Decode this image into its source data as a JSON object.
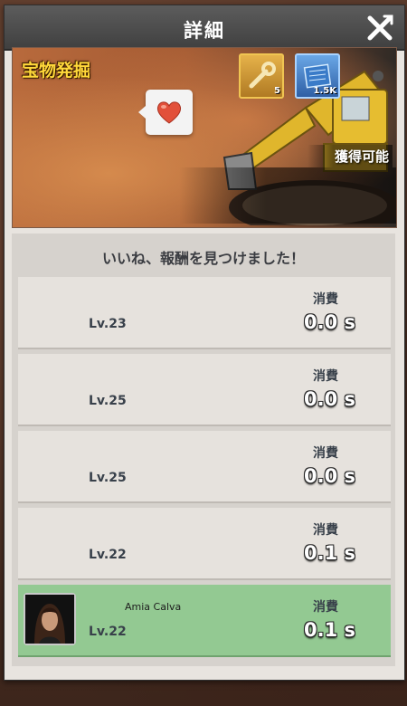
{
  "header": {
    "title": "詳細"
  },
  "banner": {
    "title": "宝物発掘",
    "obtainable_label": "獲得可能",
    "rewards": [
      {
        "icon": "wrench-icon",
        "count": "5"
      },
      {
        "icon": "blueprint-icon",
        "count": "1.5K"
      }
    ]
  },
  "message": "いいね、報酬を見つけました！",
  "rows": [
    {
      "name": "",
      "level": "Lv.23",
      "cost_label": "消費",
      "time": "0.0 s"
    },
    {
      "name": "",
      "level": "Lv.25",
      "cost_label": "消費",
      "time": "0.0 s"
    },
    {
      "name": "",
      "level": "Lv.25",
      "cost_label": "消費",
      "time": "0.0 s"
    },
    {
      "name": "",
      "level": "Lv.22",
      "cost_label": "消費",
      "time": "0.1 s"
    },
    {
      "name": "Amia Calva",
      "level": "Lv.22",
      "cost_label": "消費",
      "time": "0.1 s",
      "highlighted": true
    }
  ],
  "colors": {
    "header": "#4c4c4c",
    "highlight_row": "#93c992",
    "banner_title": "#ffd83a"
  }
}
